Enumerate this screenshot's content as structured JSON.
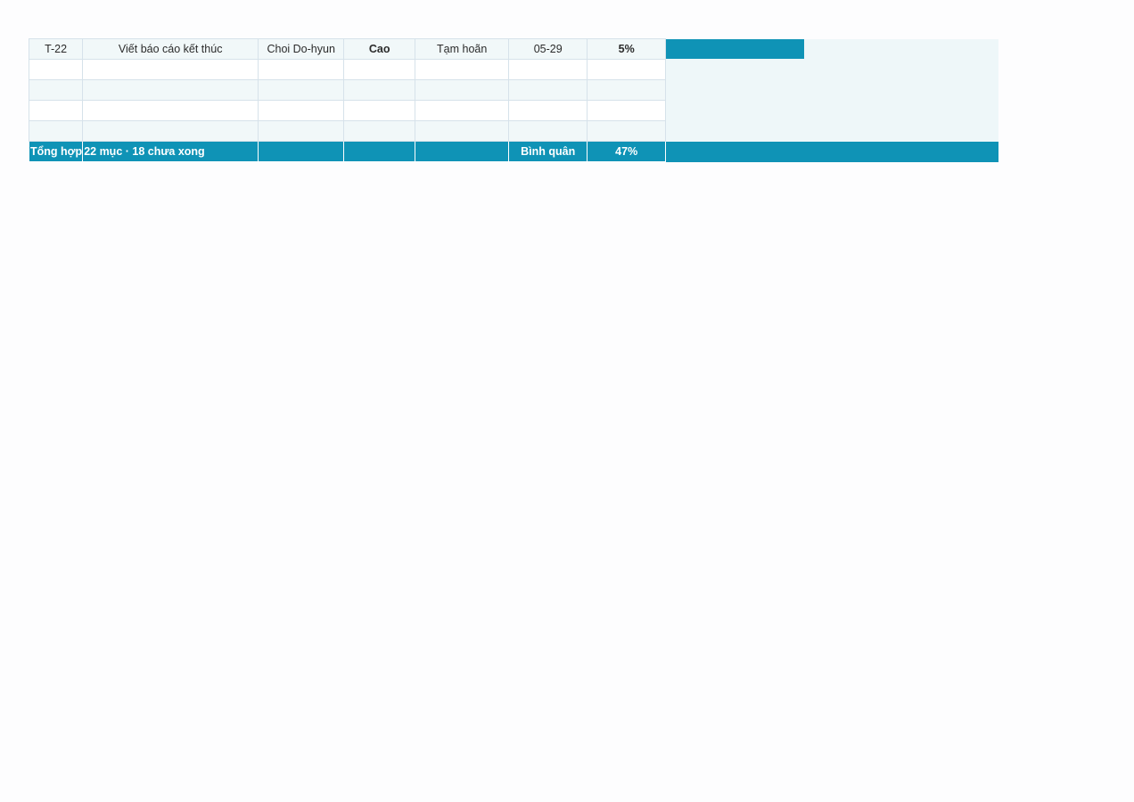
{
  "sheet": {
    "rows": [
      {
        "id": "T-22",
        "task": "Viết báo cáo kết thúc",
        "owner": "Choi Do-hyun",
        "priority": "Cao",
        "status": "Tạm hoãn",
        "due": "05-29",
        "progress": "5%",
        "progress_value": 0.05
      },
      {
        "id": "",
        "task": "",
        "owner": "",
        "priority": "",
        "status": "",
        "due": "",
        "progress": ""
      },
      {
        "id": "",
        "task": "",
        "owner": "",
        "priority": "",
        "status": "",
        "due": "",
        "progress": ""
      },
      {
        "id": "",
        "task": "",
        "owner": "",
        "priority": "",
        "status": "",
        "due": "",
        "progress": ""
      },
      {
        "id": "",
        "task": "",
        "owner": "",
        "priority": "",
        "status": "",
        "due": "",
        "progress": ""
      }
    ],
    "total": {
      "label": "Tổng hợp",
      "summary": "22 mục · 18 chưa xong",
      "avg_label": "Bình quân",
      "avg_value": "47%"
    },
    "colors": {
      "accent": "#0f93b6",
      "band": "#f1f8f9",
      "gantt_bg": "#eef7f9"
    }
  }
}
